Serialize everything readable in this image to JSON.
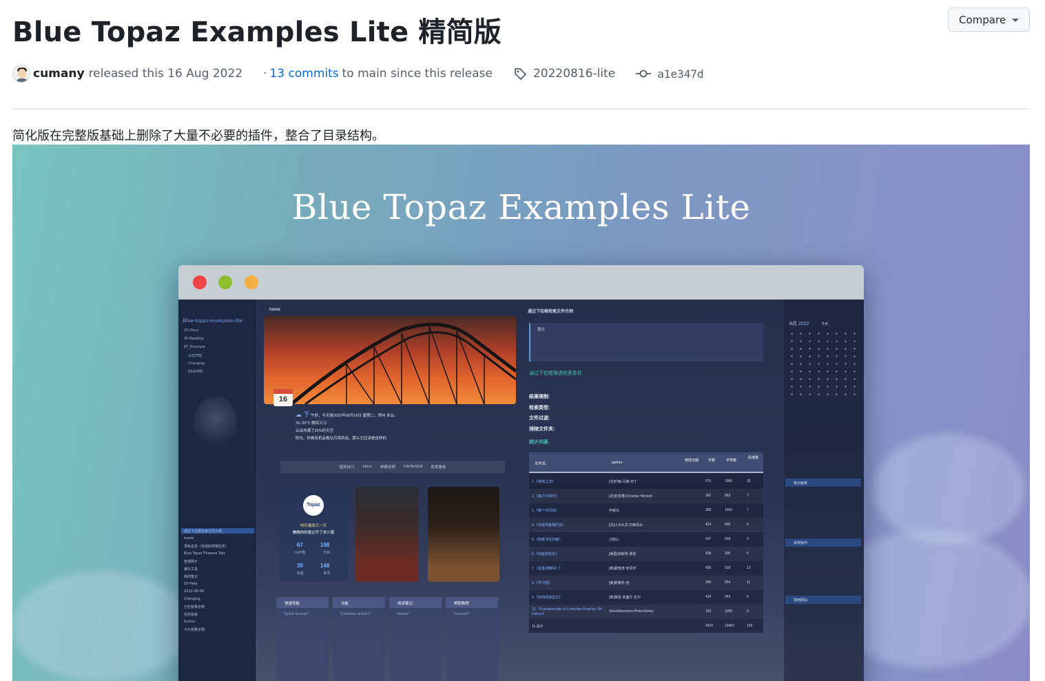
{
  "release": {
    "title": "Blue Topaz Examples Lite 精简版",
    "compare_label": "Compare",
    "author": "cumany",
    "released_text": "released this 16 Aug 2022",
    "separator": "·",
    "commits_link": "13 commits",
    "commits_suffix": "to main since this release",
    "tag": "20220816-lite",
    "commit_hash": "a1e347d",
    "description": "简化版在完整版基础上删除了大量不必要的插件，整合了目录结构。"
  },
  "hero": {
    "title": "Blue Topaz Examples Lite",
    "left_header": "home",
    "vault_name": "Blue-topaz-examples-lite",
    "sidebar_items": [
      "20-Diary",
      "30-Reading",
      "BT_Example",
      "从这开始",
      "Changlog",
      "README"
    ],
    "sidebar_lower_items": [
      "通过下拉框检索文件示例",
      "home",
      "项目总览（完成的学期任务）",
      "Blue Topaz Themes Tips",
      "普通例子",
      "番外工具",
      "我的笔记",
      "10-Help",
      "2022-06-06",
      "Changlog",
      "分栏效果示例",
      "任务看板",
      "button",
      "卡片效果示例"
    ],
    "calendar_day": "16",
    "calendar_month": "八月",
    "menu_items": [
      "使用技巧",
      "Inbox",
      "样模说明",
      "DATAVIEW",
      "影视看板"
    ],
    "stats": [
      {
        "num": "67",
        "label": "Ob天数"
      },
      {
        "num": "198",
        "label": "文档"
      },
      {
        "num": "39",
        "label": "标签"
      },
      {
        "num": "148",
        "label": "事项"
      }
    ],
    "stats_title": "快乐健康又一天",
    "stats_subtitle": "瞧瞧你的笔记写了多少篇",
    "topaz_logo": "Topaz",
    "quick_cols": [
      "快速导航",
      "功能",
      "阅读笔记",
      "帮助教程"
    ],
    "quick_sub": [
      "\"Quick Access\"",
      "\"Common actions\"",
      "\"Media\"",
      "\"Tutorials\""
    ],
    "mid_title": "通过下拉框检索文件示例",
    "tip_title": "提示",
    "mid_link": "通过下拉框筛选检索条件",
    "form_labels": [
      "结果限制:",
      "检索类型:",
      "文件过滤:",
      "排除文件夹:",
      "统计列表"
    ],
    "table_header": [
      "文件名",
      "author",
      "修改日期",
      "字数",
      "字符数",
      "段落数"
    ],
    "table_rows": [
      [
        "1.《嘿嘿之法》",
        "[法]约翰·丹维·布丁",
        "970",
        "1980",
        "33"
      ],
      [
        "2.《魔力与城市》",
        "[法]安克隆(Christian Henriot)",
        "362",
        "863",
        "7"
      ],
      [
        "3.《某个共同体》",
        "作者鸟",
        "368",
        "1055",
        "7"
      ],
      [
        "4.《全能预备赛历史》",
        "[法]小木头龙 石梅清水",
        "424",
        "956",
        "6"
      ],
      [
        "5.《和纸书写的魔》",
        "汪晓心",
        "437",
        "918",
        "9"
      ],
      [
        "6.《动画有些东》",
        "[美国]米斯特·爵恩",
        "438",
        "900",
        "5"
      ],
      [
        "7.《星金漫瞻吗？》",
        "[英]霍普德·安同学",
        "430",
        "928",
        "13"
      ],
      [
        "8.《学习馆》",
        "[美]斯蒂芬·金",
        "399",
        "854",
        "11"
      ],
      [
        "9.《如何阅读星云》",
        "[英]赛恩·安塞尔·史尔",
        "434",
        "943",
        "6"
      ],
      [
        "10.《Fundamentals of Computer Graphics 5th Edition》",
        "SteveMarschner/PeterShirley",
        "153",
        "1006",
        "3"
      ],
      [
        "11.总计",
        "",
        "4415",
        "10403",
        "102"
      ]
    ],
    "cal_month": "8月",
    "cal_year": "2022",
    "cal_today": "今天",
    "rp_sections": [
      "笔记面板",
      "常规操作",
      "常用网站"
    ]
  }
}
